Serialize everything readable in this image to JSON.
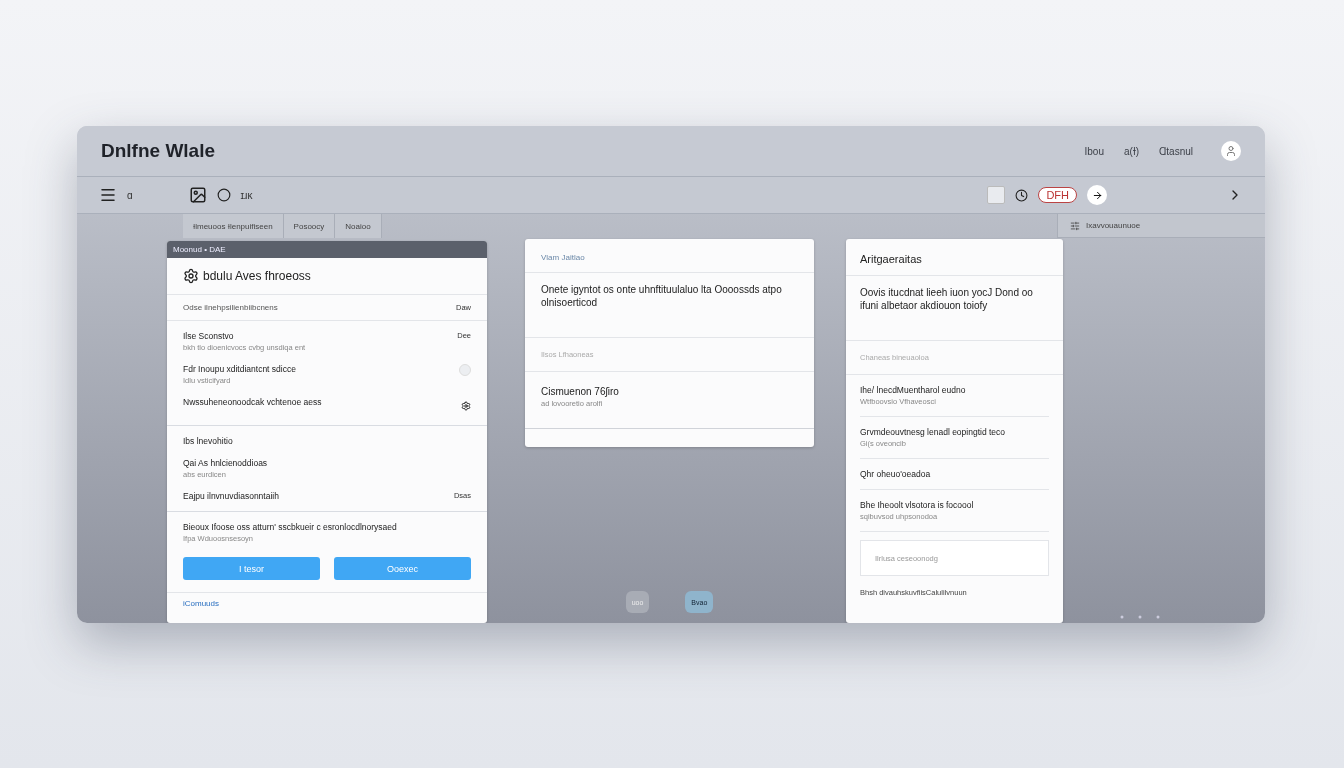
{
  "window": {
    "title": "Dnlfne Wlale"
  },
  "header_links": [
    "Ibou",
    "a(Ɨ)",
    "Ɑtasnul"
  ],
  "toolbar": {
    "menu_label": "ɑ",
    "label": "ɪɹĸ",
    "checkbox": {
      "checked": false
    },
    "badge": "DFH"
  },
  "tabs": [
    "Ɨlmeuoos Ɨlenpuifiseen",
    "Posoocy",
    "Noaioo"
  ],
  "side_header": "Ixavvouaunuoe",
  "left_card": {
    "header": "Moonud • DAE",
    "title": "bdulu Aves fhroeoss",
    "top_row": {
      "label": "Odse ilnehpsilienbiibcnens",
      "value": "Daw"
    },
    "items": [
      {
        "kind": "value",
        "title": "Ilse Sconstvo",
        "subtitle": "bkh tlo dioenicvocs cvbg unsdiqa ent",
        "value": "Dee"
      },
      {
        "kind": "toggle",
        "title": "Fdr Inoupu xditdiantcnt sdicce",
        "subtitle": "Idlu vsticifyard",
        "on": false
      },
      {
        "kind": "icon",
        "title": "Nwssuheneonoodcak vchtenoe aess"
      }
    ],
    "section_title": "Ibs lnevohitio",
    "section_items": [
      {
        "title": "Qai As hnlcienoddioas",
        "subtitle": "abs eurdicen"
      },
      {
        "title": "Eajpu ilnvnuvdiasonntaiih",
        "value": "Dsas"
      }
    ],
    "note": {
      "text": "Bieoux Ifoose oss atturn' sscbkueir c esronlocdlnorysaed",
      "sub": "Ifpa Wduoosnsesoyn"
    },
    "buttons": [
      "I tesor",
      "Ooexec"
    ],
    "footer_link": "iComuuds"
  },
  "middle_card": {
    "header": "Vlam Jaitlao",
    "text": "Onete igyntot os onte uhnftituulaluo lta Oooossds atpo olnisoerticod",
    "muted": "Ilsos Lfhaoneas",
    "item": {
      "title": "Cismuenon 76ʃiro",
      "subtitle": "ad lovooretio arolfi"
    }
  },
  "pager": [
    {
      "label": "uoo",
      "selected": false
    },
    {
      "label": "Bvao",
      "selected": true
    }
  ],
  "right_card": {
    "header": "Aritgaeraitas",
    "text": "Oovis itucdnat lieeh iuon yocJ Dond oo ifuni albetaor akdiouon toiofy",
    "muted": "Chaneas bineuaoloa",
    "items": [
      {
        "title": "Ihe/ lnecdMuentharol eudno",
        "subtitle": "Wtfboovsio Vfhaveosci"
      },
      {
        "title": "Grvmdeouvtnesg lenadl eopingtid teco",
        "subtitle": "Gi(s oveoncib"
      },
      {
        "title": "Qhr oheuo'oeadoa"
      },
      {
        "title": "Bhe Iheoolt vlsotora is focoool",
        "subtitle": "sqibuvsod uhpsonodoa"
      }
    ],
    "field": {
      "placeholder": "Ilrlusa ceseoonodg"
    },
    "footer": "Bhsh divauhskuvfiisCalulilvnuun"
  }
}
